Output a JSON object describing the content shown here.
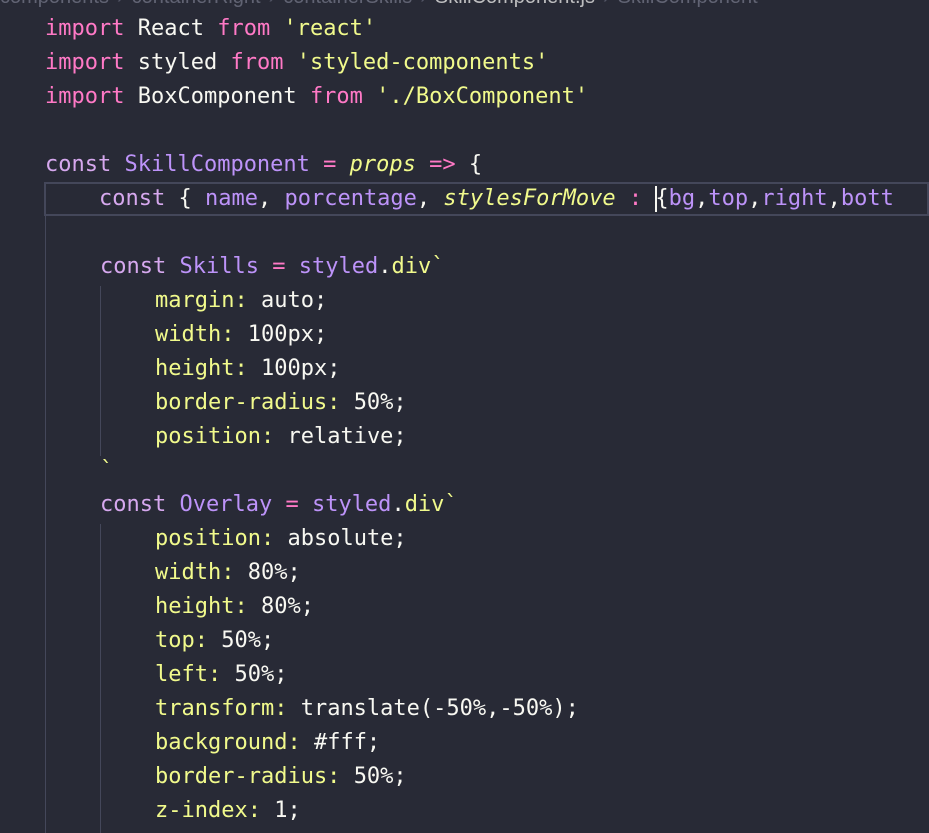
{
  "breadcrumb": {
    "items": [
      "components",
      "containerRight",
      "containerSkills",
      "SkillComponent.js",
      "SkillComponent"
    ],
    "separator": "›"
  },
  "colors": {
    "background": "#282a36",
    "keyword": "#ff79c6",
    "string": "#f1fa8c",
    "identifier": "#f8f8f2",
    "function": "#bd93f9",
    "guide": "#44475a"
  },
  "code": {
    "l1": {
      "kw": "import",
      "name": "React",
      "from": "from",
      "str": "'react'"
    },
    "l2": {
      "kw": "import",
      "name": "styled",
      "from": "from",
      "str": "'styled-components'"
    },
    "l3": {
      "kw": "import",
      "name": "BoxComponent",
      "from": "from",
      "str": "'./BoxComponent'"
    },
    "l5": {
      "kw": "const",
      "name": "SkillComponent",
      "eq": "=",
      "param": "props",
      "arrow": "=>",
      "brace": "{"
    },
    "l6": {
      "kw": "const",
      "open": "{",
      "a": "name",
      "b": "porcentage",
      "c": "stylesForMove",
      "colon": ":",
      "open2": "{",
      "d": "bg",
      "e": "top",
      "f": "right",
      "g": "bott"
    },
    "l8": {
      "kw": "const",
      "name": "Skills",
      "eq": "=",
      "obj": "styled",
      "dot": ".",
      "tag": "div",
      "tick": "`"
    },
    "skills_css": [
      {
        "prop": "margin:",
        "val": "auto;"
      },
      {
        "prop": "width:",
        "val": "100px;"
      },
      {
        "prop": "height:",
        "val": "100px;"
      },
      {
        "prop": "border-radius:",
        "val": "50%;"
      },
      {
        "prop": "position:",
        "val": "relative;"
      }
    ],
    "l14": {
      "tick": "`"
    },
    "l15": {
      "kw": "const",
      "name": "Overlay",
      "eq": "=",
      "obj": "styled",
      "dot": ".",
      "tag": "div",
      "tick": "`"
    },
    "overlay_css": [
      {
        "prop": "position:",
        "val": "absolute;"
      },
      {
        "prop": "width:",
        "val": "80%;"
      },
      {
        "prop": "height:",
        "val": "80%;"
      },
      {
        "prop": "top:",
        "val": "50%;"
      },
      {
        "prop": "left:",
        "val": "50%;"
      },
      {
        "prop": "transform:",
        "val": "translate(-50%,-50%);"
      },
      {
        "prop": "background:",
        "val": "#fff;"
      },
      {
        "prop": "border-radius:",
        "val": "50%;"
      },
      {
        "prop": "z-index:",
        "val": "1;"
      }
    ]
  }
}
